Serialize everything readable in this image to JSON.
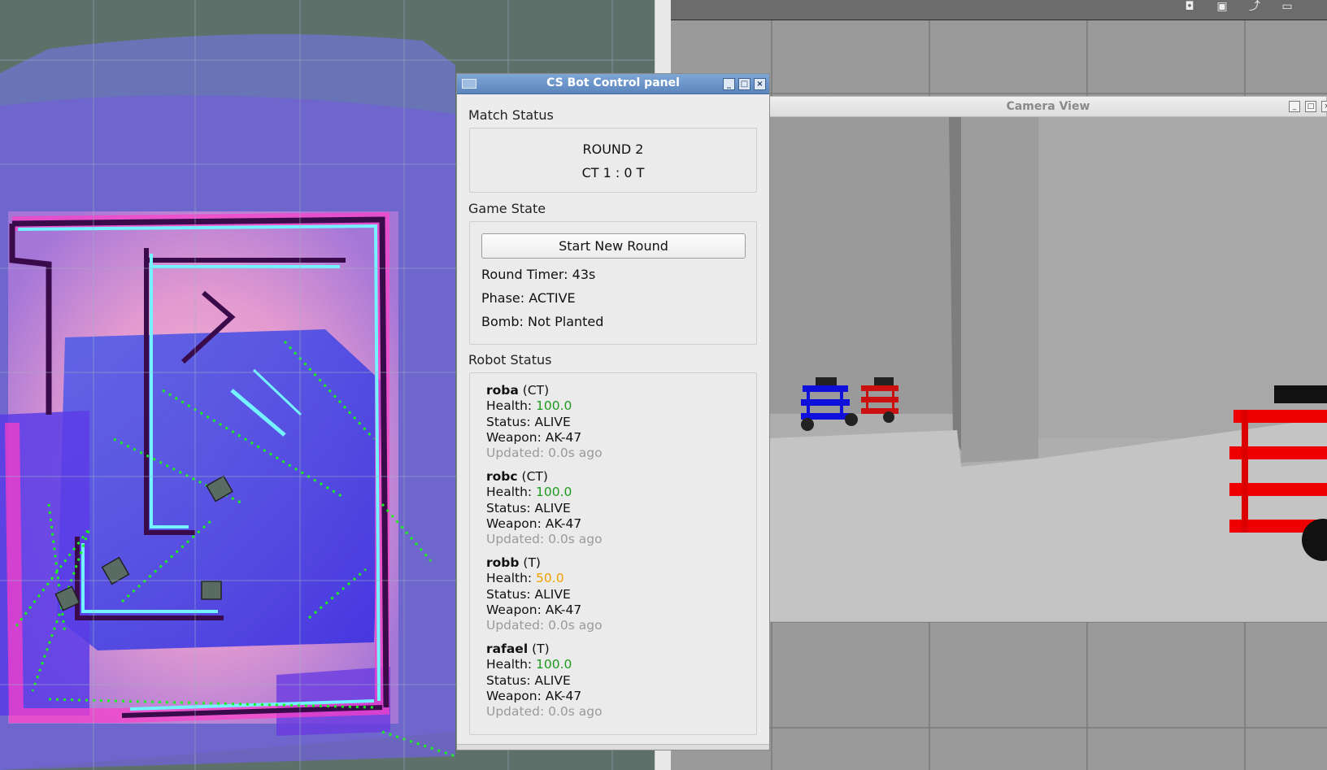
{
  "panel": {
    "title": "CS Bot Control panel",
    "match_status_label": "Match Status",
    "round_text": "ROUND 2",
    "score_text": "CT 1 : 0 T",
    "game_state_label": "Game State",
    "start_button_label": "Start New Round",
    "round_timer": "Round Timer: 43s",
    "phase": "Phase: ACTIVE",
    "bomb": "Bomb: Not Planted",
    "robot_status_label": "Robot Status",
    "health_prefix": "Health: ",
    "robots": [
      {
        "name": "roba",
        "team": "(CT)",
        "health": "100.0",
        "health_color": "#1e9b1e",
        "status": "Status: ALIVE",
        "weapon": "Weapon: AK-47",
        "updated": "Updated: 0.0s ago"
      },
      {
        "name": "robc",
        "team": "(CT)",
        "health": "100.0",
        "health_color": "#1e9b1e",
        "status": "Status: ALIVE",
        "weapon": "Weapon: AK-47",
        "updated": "Updated: 0.0s ago"
      },
      {
        "name": "robb",
        "team": "(T)",
        "health": "50.0",
        "health_color": "#f0a000",
        "status": "Status: ALIVE",
        "weapon": "Weapon: AK-47",
        "updated": "Updated: 0.0s ago"
      },
      {
        "name": "rafael",
        "team": "(T)",
        "health": "100.0",
        "health_color": "#1e9b1e",
        "status": "Status: ALIVE",
        "weapon": "Weapon: AK-47",
        "updated": "Updated: 0.0s ago"
      }
    ]
  },
  "camera": {
    "title": "Camera View"
  },
  "icons": {
    "minimize": "minimize-icon",
    "maximize": "maximize-icon",
    "close": "close-icon"
  }
}
